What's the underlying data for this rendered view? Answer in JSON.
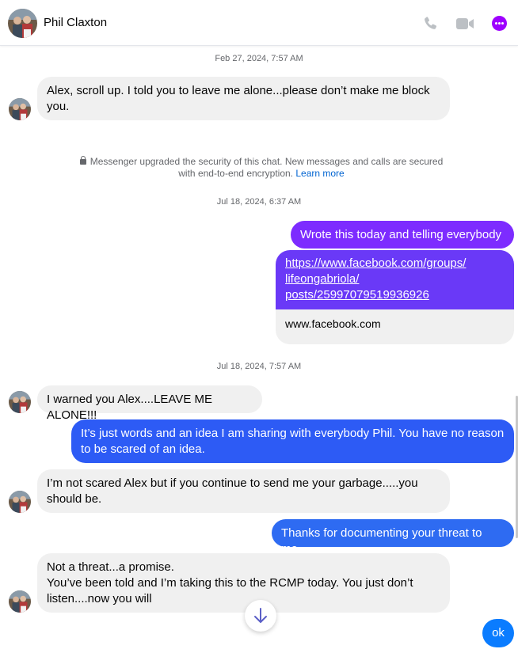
{
  "header": {
    "contact_name": "Phil Claxton",
    "icons": [
      "phone-icon",
      "video-icon",
      "more-icon"
    ],
    "accent": "#9e00ff"
  },
  "thread": {
    "timestamps": [
      "Feb 27, 2024, 7:57 AM",
      "Jul 18, 2024, 6:37 AM",
      "Jul 18, 2024, 7:57 AM"
    ],
    "security_notice": {
      "line1": "Messenger upgraded the security of this chat. New messages and calls are secured",
      "line2": "with end-to-end encryption. ",
      "link": "Learn more"
    },
    "messages": [
      {
        "from": "Phil Claxton",
        "lines": [
          "Alex, scroll up. I told you to leave me alone...please don’t make me block",
          "you."
        ]
      },
      {
        "from": "me",
        "lines": [
          "Wrote this today and telling everybody"
        ]
      },
      {
        "from": "me",
        "type": "link",
        "url_lines": [
          "https://www.facebook.com/groups/",
          "lifeongabriola/",
          "posts/25997079519936926"
        ],
        "domain": "www.facebook.com"
      },
      {
        "from": "Phil Claxton",
        "lines": [
          "I warned you Alex....LEAVE ME ALONE!!!"
        ]
      },
      {
        "from": "me",
        "lines": [
          "It’s just words and an idea I am sharing with everybody Phil.   You have no reason",
          "to be scared of an idea."
        ]
      },
      {
        "from": "Phil Claxton",
        "lines": [
          "I’m not scared Alex but if you continue to send me your garbage.....you",
          "should be."
        ]
      },
      {
        "from": "me",
        "lines": [
          "Thanks for documenting your threat to me."
        ]
      },
      {
        "from": "Phil Claxton",
        "lines": [
          "Not a threat...a promise.",
          "You’ve been told and I’m taking this to the RCMP today. You just don’t",
          "listen....now you will"
        ]
      }
    ]
  },
  "controls": {
    "scroll_down_icon": "arrow-down-icon",
    "ok_label": "ok"
  },
  "colors": {
    "incoming_bubble": "#f0f0f0",
    "outgoing_purple": "#7d2cff",
    "outgoing_blue": "#2d5bf5",
    "ok_button": "#0a7cff"
  }
}
